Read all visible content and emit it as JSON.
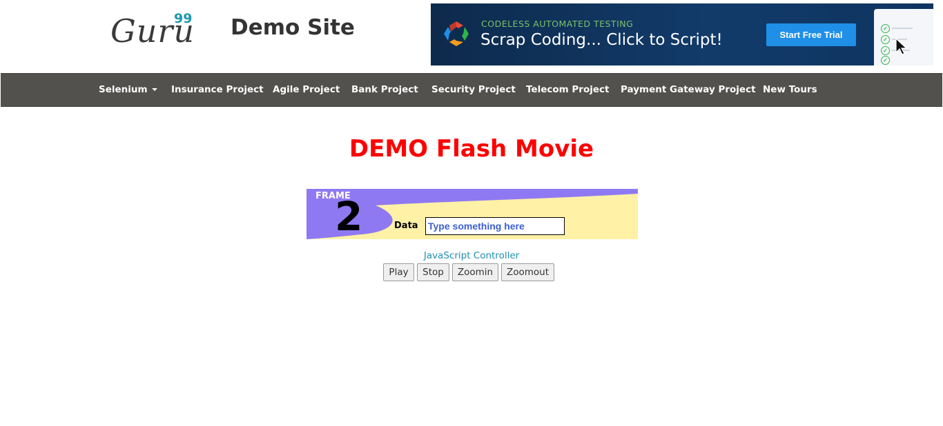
{
  "header": {
    "logo_text": "Guru",
    "logo_superscript": "99",
    "site_title": "Demo Site"
  },
  "ad": {
    "eyebrow": "CODELESS AUTOMATED TESTING",
    "headline": "Scrap Coding... Click to Script!",
    "cta_label": "Start Free Trial",
    "accent_color": "#1f8fe8"
  },
  "nav": {
    "items": [
      {
        "label": "Selenium",
        "has_dropdown": true
      },
      {
        "label": "Insurance Project"
      },
      {
        "label": "Agile Project"
      },
      {
        "label": "Bank Project"
      },
      {
        "label": "Security Project"
      },
      {
        "label": "Telecom Project"
      },
      {
        "label": "Payment Gateway Project"
      },
      {
        "label": "New Tours"
      }
    ]
  },
  "main": {
    "title": "DEMO Flash Movie",
    "title_color": "#ff0000",
    "flash": {
      "frame_label": "FRAME",
      "frame_number": "2",
      "data_label": "Data",
      "input_placeholder": "Type something here"
    },
    "controller_label": "JavaScript Controller",
    "buttons": {
      "play": "Play",
      "stop": "Stop",
      "zoomin": "Zoomin",
      "zoomout": "Zoomout"
    }
  }
}
